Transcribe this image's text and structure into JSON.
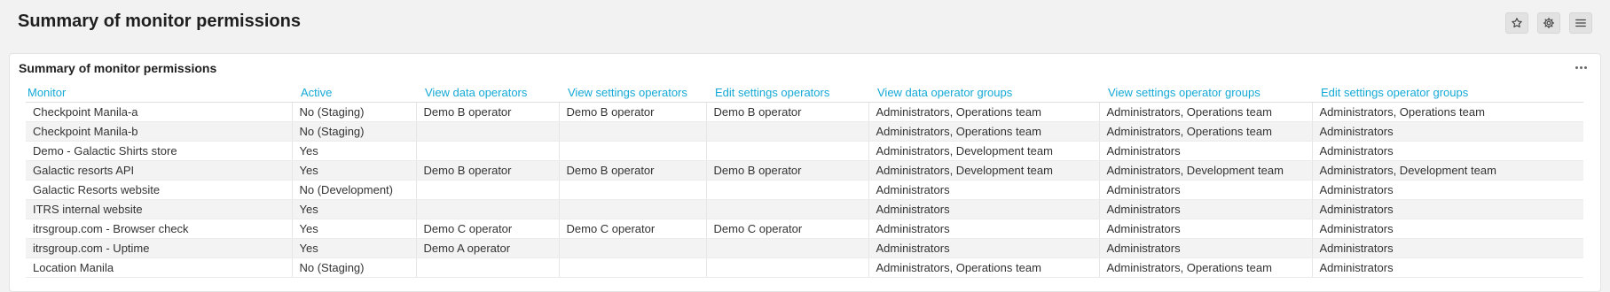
{
  "page": {
    "title": "Summary of monitor permissions"
  },
  "header_buttons": [
    {
      "icon": "star-icon"
    },
    {
      "icon": "gear-icon"
    },
    {
      "icon": "hamburger-menu-icon"
    }
  ],
  "panel": {
    "title": "Summary of monitor permissions",
    "menu_icon": "more-horizontal-icon"
  },
  "table": {
    "columns": [
      "Monitor",
      "Active",
      "View data operators",
      "View settings operators",
      "Edit settings operators",
      "View data operator groups",
      "View settings operator groups",
      "Edit settings operator groups"
    ],
    "rows": [
      [
        "Checkpoint Manila-a",
        "No (Staging)",
        "Demo B operator",
        "Demo B operator",
        "Demo B operator",
        "Administrators, Operations team",
        "Administrators, Operations team",
        "Administrators, Operations team"
      ],
      [
        "Checkpoint Manila-b",
        "No (Staging)",
        "",
        "",
        "",
        "Administrators, Operations team",
        "Administrators, Operations team",
        "Administrators"
      ],
      [
        "Demo - Galactic Shirts store",
        "Yes",
        "",
        "",
        "",
        "Administrators, Development team",
        "Administrators",
        "Administrators"
      ],
      [
        "Galactic resorts API",
        "Yes",
        "Demo B operator",
        "Demo B operator",
        "Demo B operator",
        "Administrators, Development team",
        "Administrators, Development team",
        "Administrators, Development team"
      ],
      [
        "Galactic Resorts website",
        "No (Development)",
        "",
        "",
        "",
        "Administrators",
        "Administrators",
        "Administrators"
      ],
      [
        "ITRS internal website",
        "Yes",
        "",
        "",
        "",
        "Administrators",
        "Administrators",
        "Administrators"
      ],
      [
        "itrsgroup.com - Browser check",
        "Yes",
        "Demo C operator",
        "Demo C operator",
        "Demo C operator",
        "Administrators",
        "Administrators",
        "Administrators"
      ],
      [
        "itrsgroup.com - Uptime",
        "Yes",
        "Demo A operator",
        "",
        "",
        "Administrators",
        "Administrators",
        "Administrators"
      ],
      [
        "Location Manila",
        "No (Staging)",
        "",
        "",
        "",
        "Administrators, Operations team",
        "Administrators, Operations team",
        "Administrators"
      ]
    ]
  },
  "colors": {
    "header_link": "#14a9d6",
    "page_background": "#f2f2f2",
    "panel_background": "#ffffff",
    "alt_row": "#f3f3f3"
  }
}
